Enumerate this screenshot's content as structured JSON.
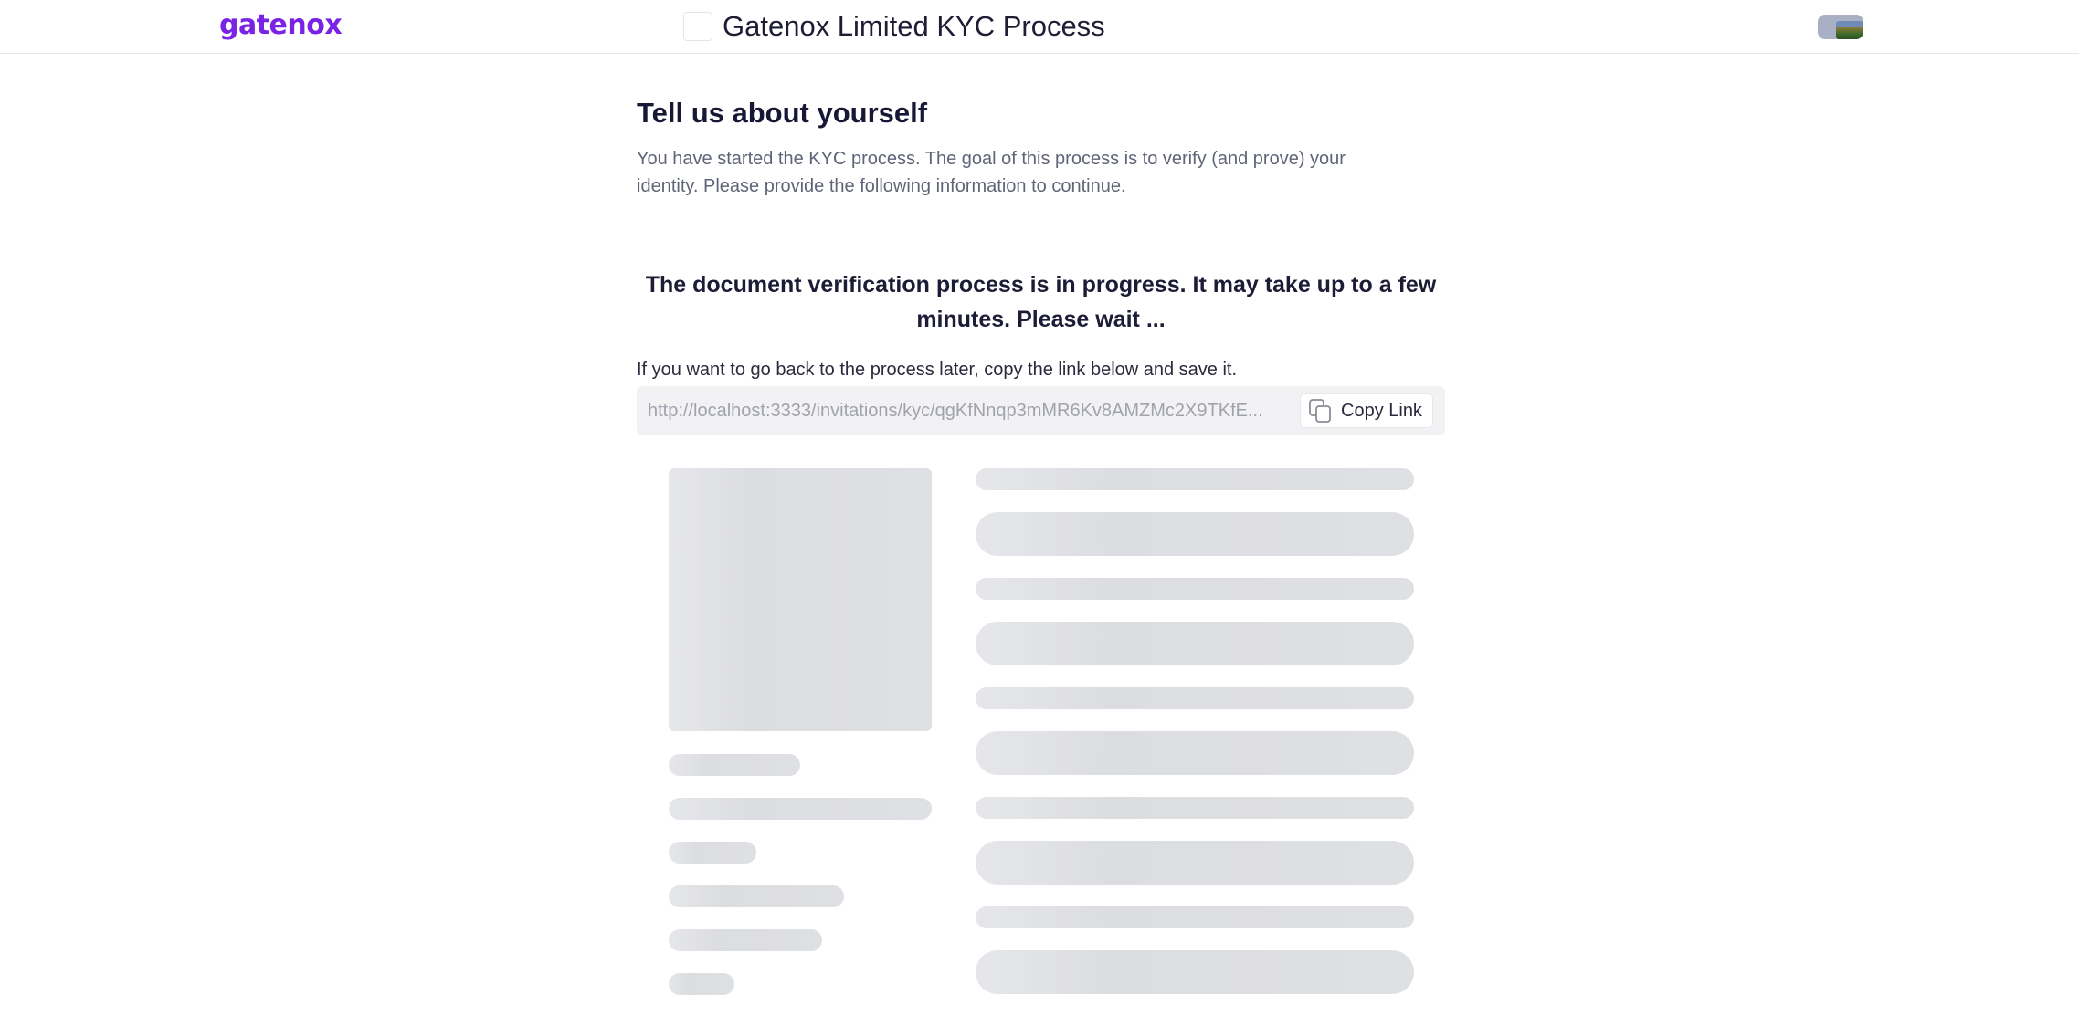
{
  "header": {
    "brand": "gatenox",
    "process_title": "Gatenox Limited KYC Process",
    "avatar_icon": "user-avatar-icon"
  },
  "main": {
    "title": "Tell us about yourself",
    "description": "You have started the KYC process. The goal of this process is to verify (and prove) your identity. Please provide the following information to continue.",
    "status_message": "The document verification process is in progress. It may take up to a few minutes. Please wait ...",
    "save_hint": "If you want to go back to the process later, copy the link below and save it.",
    "invitation_link": "http://localhost:3333/invitations/kyc/qgKfNnqp3mMR6Kv8AMZMc2X9TKfE...",
    "copy_button_label": "Copy Link",
    "copy_icon": "copy-icon"
  },
  "colors": {
    "brand": "#7a22e6",
    "skeleton": "#dcdde1",
    "link_box_bg": "#f2f2f4"
  }
}
